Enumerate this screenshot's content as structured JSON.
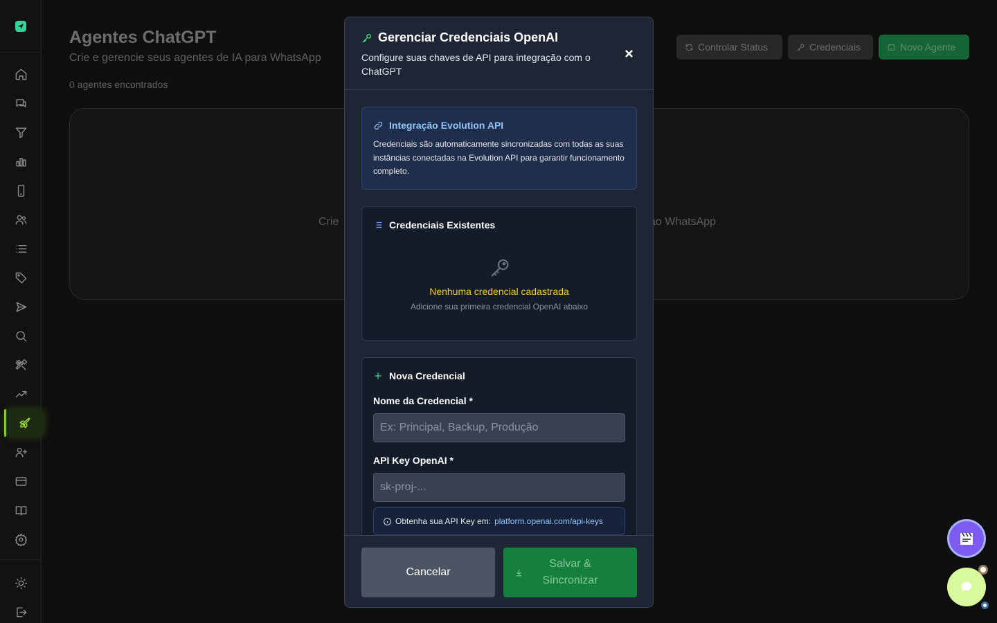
{
  "sidebar": {
    "items": [
      {
        "name": "home-icon"
      },
      {
        "name": "chat-icon"
      },
      {
        "name": "filter-icon"
      },
      {
        "name": "bar-chart-icon"
      },
      {
        "name": "phone-icon"
      },
      {
        "name": "users-icon"
      },
      {
        "name": "list-icon"
      },
      {
        "name": "tag-icon"
      },
      {
        "name": "send-icon"
      },
      {
        "name": "search-icon"
      },
      {
        "name": "tools-icon"
      },
      {
        "name": "trending-icon"
      },
      {
        "name": "rocket-icon"
      },
      {
        "name": "user-plus-icon"
      },
      {
        "name": "credit-card-icon"
      },
      {
        "name": "book-icon"
      },
      {
        "name": "settings-icon"
      },
      {
        "name": "sun-icon"
      },
      {
        "name": "logout-icon"
      }
    ],
    "active": "rocket-icon"
  },
  "page": {
    "title": "Agentes ChatGPT",
    "subtitle": "Crie e gerencie seus agentes de IA para WhatsApp",
    "count": "0 agentes encontrados",
    "empty_left": "Crie",
    "empty_right": "ao WhatsApp"
  },
  "toolbar": {
    "status_label": "Controlar Status",
    "credentials_label": "Credenciais",
    "new_agent_label": "Novo Agente"
  },
  "modal": {
    "title": "Gerenciar Credenciais OpenAI",
    "description": "Configure suas chaves de API para integração com o ChatGPT",
    "info": {
      "title": "Integração Evolution API",
      "text": "Credenciais são automaticamente sincronizadas com todas as suas instâncias conectadas na Evolution API para garantir funcionamento completo."
    },
    "existing": {
      "title": "Credenciais Existentes",
      "empty_title": "Nenhuma credencial cadastrada",
      "empty_sub": "Adicione sua primeira credencial OpenAI abaixo"
    },
    "new_credential": {
      "title": "Nova Credencial",
      "name_label": "Nome da Credencial *",
      "name_placeholder": "Ex: Principal, Backup, Produção",
      "name_value": "",
      "key_label": "API Key OpenAI *",
      "key_placeholder": "sk-proj-...",
      "key_value": "",
      "hint_text": "Obtenha sua API Key em:",
      "hint_link": "platform.openai.com/api-keys"
    },
    "footer": {
      "cancel_label": "Cancelar",
      "save_label": "Salvar & Sincronizar"
    }
  },
  "colors": {
    "accent_green": "#16a34a",
    "sidebar_active": "#84cc16",
    "info_blue": "#93c5fd",
    "warning_yellow": "#facc15"
  }
}
